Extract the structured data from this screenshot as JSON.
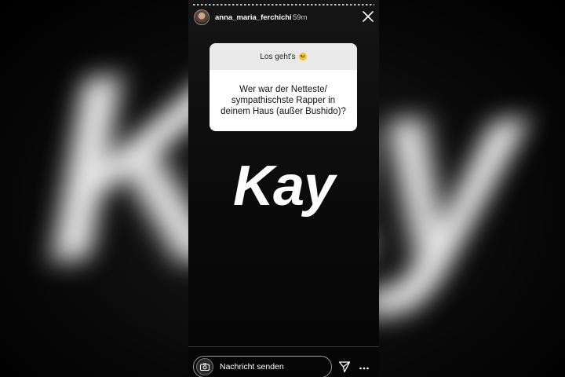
{
  "background": {
    "word": "Kay"
  },
  "story": {
    "user": {
      "username": "anna_maria_ferchichi",
      "time": "59m"
    },
    "question": {
      "header": "Los geht's",
      "header_emoji": "slightly-frowning-face-emoji",
      "text": "Wer war der Netteste/ sympathischste Rapper in deinem Haus (außer Bushido)?"
    },
    "answer": "Kay",
    "footer": {
      "message_placeholder": "Nachricht senden"
    }
  },
  "icons": {
    "close": "close-icon",
    "camera": "camera-icon",
    "send": "send-icon",
    "more": "more-icon"
  },
  "colors": {
    "card_header_bg": "#e9e9e9",
    "text_light": "#ffffff"
  }
}
